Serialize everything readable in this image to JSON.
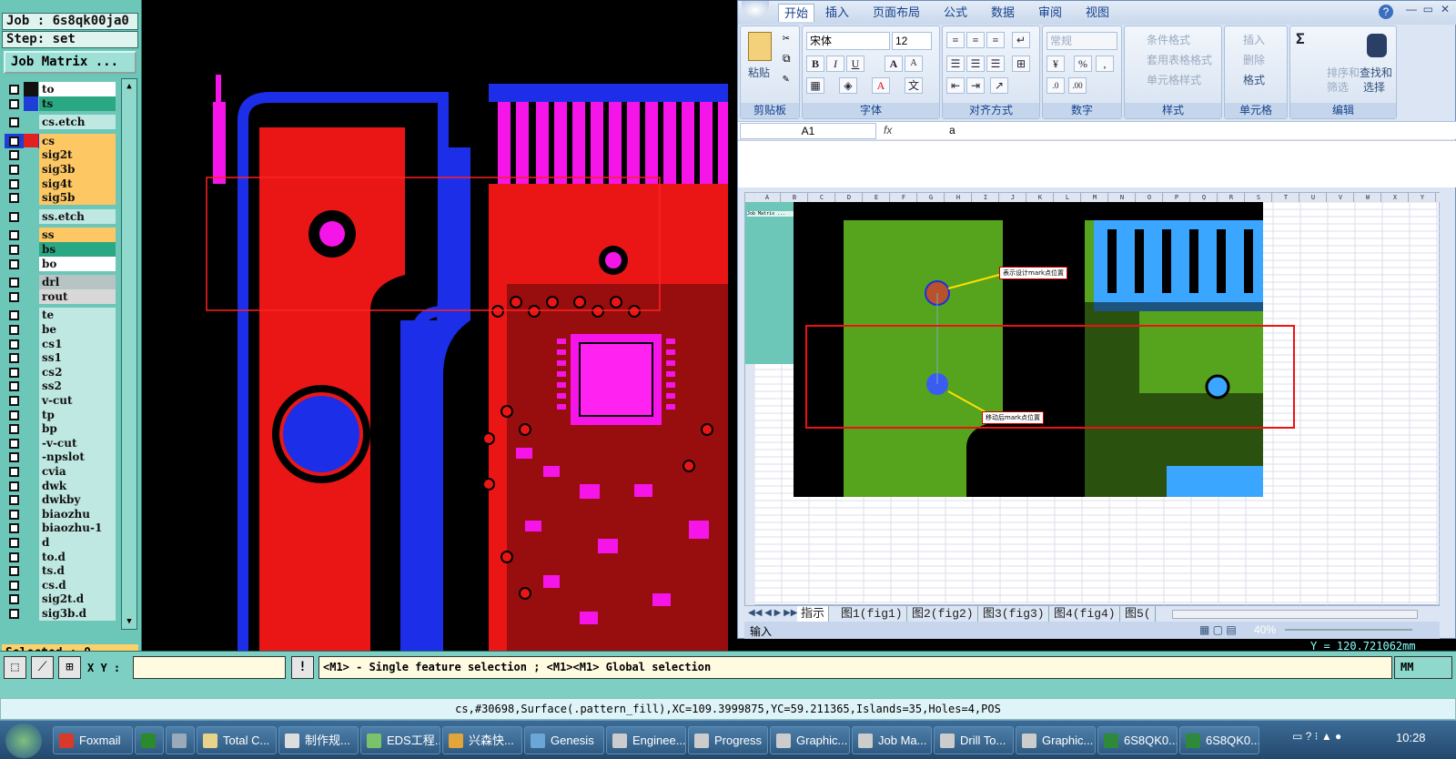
{
  "genesis": {
    "job_label": "Job : 6s8qk00ja0",
    "step_label": "Step: set",
    "job_matrix_button": "Job Matrix ...",
    "layers": [
      {
        "name": "to",
        "color": "#111111",
        "bg": "#ffffff",
        "group": 0
      },
      {
        "name": "ts",
        "color": "#1d3fd8",
        "bg": "#2aa884",
        "group": 0
      },
      {
        "name": "cs.etch",
        "color": "",
        "bg": "#bfe8e2",
        "group": 1
      },
      {
        "name": "cs",
        "color": "#e32020",
        "bg": "#fdc764",
        "group": 2,
        "active": true
      },
      {
        "name": "sig2t",
        "color": "",
        "bg": "#fdc764",
        "group": 2
      },
      {
        "name": "sig3b",
        "color": "",
        "bg": "#fdc764",
        "group": 2
      },
      {
        "name": "sig4t",
        "color": "",
        "bg": "#fdc764",
        "group": 2
      },
      {
        "name": "sig5b",
        "color": "",
        "bg": "#fdc764",
        "group": 2
      },
      {
        "name": "ss.etch",
        "color": "",
        "bg": "#bfe8e2",
        "group": 3
      },
      {
        "name": "ss",
        "color": "",
        "bg": "#fdc764",
        "group": 4
      },
      {
        "name": "bs",
        "color": "",
        "bg": "#2aa884",
        "group": 4
      },
      {
        "name": "bo",
        "color": "",
        "bg": "#ffffff",
        "group": 4
      },
      {
        "name": "drl",
        "color": "",
        "bg": "#b8c4c4",
        "group": 5
      },
      {
        "name": "rout",
        "color": "",
        "bg": "#d8d8d8",
        "group": 5
      },
      {
        "name": "te",
        "color": "",
        "bg": "#bfe8e2",
        "group": 6
      },
      {
        "name": "be",
        "color": "",
        "bg": "#bfe8e2",
        "group": 6
      },
      {
        "name": "cs1",
        "color": "",
        "bg": "#bfe8e2",
        "group": 6
      },
      {
        "name": "ss1",
        "color": "",
        "bg": "#bfe8e2",
        "group": 6
      },
      {
        "name": "cs2",
        "color": "",
        "bg": "#bfe8e2",
        "group": 6
      },
      {
        "name": "ss2",
        "color": "",
        "bg": "#bfe8e2",
        "group": 6
      },
      {
        "name": "v-cut",
        "color": "",
        "bg": "#bfe8e2",
        "group": 6
      },
      {
        "name": "tp",
        "color": "",
        "bg": "#bfe8e2",
        "group": 6
      },
      {
        "name": "bp",
        "color": "",
        "bg": "#bfe8e2",
        "group": 6
      },
      {
        "name": "-v-cut",
        "color": "",
        "bg": "#bfe8e2",
        "group": 6
      },
      {
        "name": "-npslot",
        "color": "",
        "bg": "#bfe8e2",
        "group": 6
      },
      {
        "name": "cvia",
        "color": "",
        "bg": "#bfe8e2",
        "group": 6
      },
      {
        "name": "dwk",
        "color": "",
        "bg": "#bfe8e2",
        "group": 6
      },
      {
        "name": "dwkby",
        "color": "",
        "bg": "#bfe8e2",
        "group": 6
      },
      {
        "name": "biaozhu",
        "color": "",
        "bg": "#bfe8e2",
        "group": 6
      },
      {
        "name": "biaozhu-1",
        "color": "",
        "bg": "#bfe8e2",
        "group": 6
      },
      {
        "name": "d",
        "color": "",
        "bg": "#bfe8e2",
        "group": 6
      },
      {
        "name": "to.d",
        "color": "",
        "bg": "#bfe8e2",
        "group": 6
      },
      {
        "name": "ts.d",
        "color": "",
        "bg": "#bfe8e2",
        "group": 6
      },
      {
        "name": "cs.d",
        "color": "",
        "bg": "#bfe8e2",
        "group": 6
      },
      {
        "name": "sig2t.d",
        "color": "",
        "bg": "#bfe8e2",
        "group": 6
      },
      {
        "name": "sig3b.d",
        "color": "",
        "bg": "#bfe8e2",
        "group": 6
      }
    ],
    "selected": "Selected : 0",
    "xy_label": "X Y :",
    "xy_value": "",
    "hint": "<M1> - Single feature selection ; <M1><M1> Global selection",
    "units": "MM",
    "y_readout": "Y = 120.721062mm",
    "status": "cs,#30698,Surface(.pattern_fill),XC=109.3999875,YC=59.211365,Islands=35,Holes=4,POS"
  },
  "excel": {
    "tabs": [
      "开始",
      "插入",
      "页面布局",
      "公式",
      "数据",
      "审阅",
      "视图"
    ],
    "active_tab": "开始",
    "clipboard": {
      "paste": "粘贴",
      "label": "剪贴板"
    },
    "font": {
      "name": "宋体",
      "size": "12",
      "label": "字体",
      "bold": "B",
      "italic": "I",
      "underline": "U",
      "grow": "A",
      "shrink": "A"
    },
    "alignment": {
      "label": "对齐方式"
    },
    "number": {
      "format": "常规",
      "label": "数字",
      "percent": "%"
    },
    "styles": {
      "cond": "条件格式",
      "table": "套用表格格式",
      "cell": "单元格样式",
      "label": "样式"
    },
    "cells": {
      "insert": "插入",
      "delete": "删除",
      "format": "格式",
      "label": "单元格"
    },
    "editing": {
      "sort": "排序和",
      "filter": "筛选",
      "find": "查找和",
      "select": "选择",
      "label": "编辑",
      "sigma": "Σ"
    },
    "namebox": "A1",
    "formula": "a",
    "fx": "fx",
    "columns": [
      "A",
      "B",
      "C",
      "D",
      "E",
      "F",
      "G",
      "H",
      "I",
      "J",
      "K",
      "L",
      "M",
      "N",
      "O",
      "P",
      "Q",
      "R",
      "S",
      "T",
      "U",
      "V",
      "W",
      "X",
      "Y"
    ],
    "annot1": "表示设计mark点位置",
    "annot2": "移动后mark点位置",
    "sheet_tabs": [
      "指示",
      "图1(fig1)",
      "图2(fig2)",
      "图3(fig3)",
      "图4(fig4)",
      "图5("
    ],
    "status_text": "输入",
    "zoom": "40%",
    "embedded_job": "Job Matrix ..."
  },
  "taskbar": {
    "items": [
      {
        "label": "Foxmail",
        "color": "#d8392a"
      },
      {
        "label": "",
        "color": "#2b8a2b"
      },
      {
        "label": "",
        "color": "#9ab"
      },
      {
        "label": "Total C...",
        "color": "#e7d38a"
      },
      {
        "label": "制作规...",
        "color": "#ddd"
      },
      {
        "label": "EDS工程...",
        "color": "#7ac36a"
      },
      {
        "label": "兴森快...",
        "color": "#e2a53a"
      },
      {
        "label": "Genesis",
        "color": "#6aa6d6"
      },
      {
        "label": "Enginee...",
        "color": "#ccc"
      },
      {
        "label": "Progress",
        "color": "#ccc"
      },
      {
        "label": "Graphic...",
        "color": "#ccc"
      },
      {
        "label": "Job Ma...",
        "color": "#ccc"
      },
      {
        "label": "Drill To...",
        "color": "#ccc"
      },
      {
        "label": "Graphic...",
        "color": "#ccc"
      },
      {
        "label": "6S8QK0...",
        "color": "#2d8a3a"
      },
      {
        "label": "6S8QK0...",
        "color": "#2d8a3a"
      }
    ],
    "time": "10:28"
  }
}
